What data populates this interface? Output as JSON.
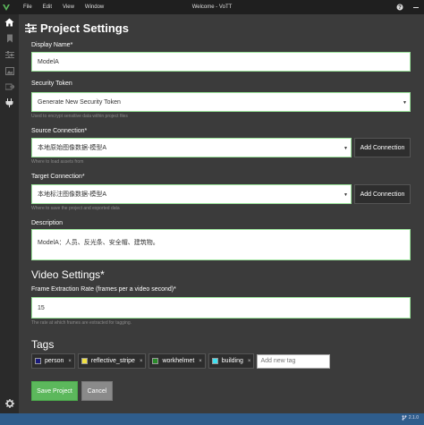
{
  "window": {
    "title": "Welcome - VoTT",
    "menu": [
      "File",
      "Edit",
      "View",
      "Window"
    ],
    "help_icon": "question-icon",
    "minimize_icon": "minimize-icon"
  },
  "page": {
    "title": "Project Settings"
  },
  "form": {
    "display_name": {
      "label": "Display Name*",
      "value": "ModelA"
    },
    "security_token": {
      "label": "Security Token",
      "value": "Generate New Security Token",
      "help": "Used to encrypt sensitive data within project files"
    },
    "source_connection": {
      "label": "Source Connection*",
      "value": "本地原始图像数据-模型A",
      "help": "Where to load assets from",
      "add_label": "Add Connection"
    },
    "target_connection": {
      "label": "Target Connection*",
      "value": "本地标注图像数据-模型A",
      "help": "Where to save the project and exported data",
      "add_label": "Add Connection"
    },
    "description": {
      "label": "Description",
      "value": "ModelA：人员、反光条、安全帽、建筑物。"
    }
  },
  "video": {
    "title": "Video Settings*",
    "frame_rate": {
      "label": "Frame Extraction Rate (frames per a video second)*",
      "value": "15",
      "help": "The rate at which frames are extracted for tagging."
    }
  },
  "tags": {
    "title": "Tags",
    "items": [
      {
        "name": "person",
        "color": "#1a1a7a"
      },
      {
        "name": "reflective_stripe",
        "color": "#f0e040"
      },
      {
        "name": "workhelmet",
        "color": "#2a8a2a"
      },
      {
        "name": "building",
        "color": "#40e0f0"
      }
    ],
    "remove_glyph": "×",
    "new_placeholder": "Add new tag"
  },
  "actions": {
    "save": "Save Project",
    "cancel": "Cancel"
  },
  "status": {
    "version": "2.1.0"
  }
}
